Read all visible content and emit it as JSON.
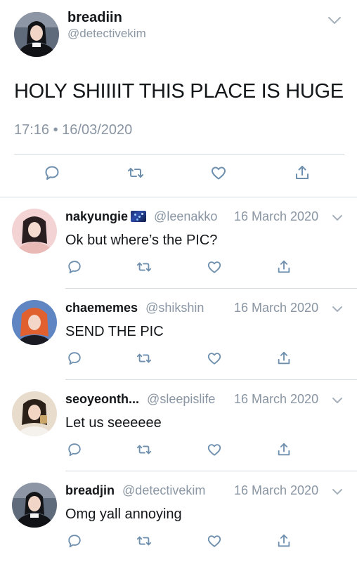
{
  "main_tweet": {
    "display_name": "breadiin",
    "handle": "@detectivekim",
    "text": "HOLY SHIIIIT THIS PLACE IS HUGE",
    "timestamp": "17:16 • 16/03/2020",
    "actions": [
      "reply-icon",
      "retweet-icon",
      "like-icon",
      "share-icon"
    ]
  },
  "replies": [
    {
      "display_name": "nakyungie",
      "has_flag_emoji": true,
      "handle": "@leenakko",
      "date": "16 March 2020",
      "text": "Ok but where’s the PIC?",
      "avatar_colors": [
        "#f2cfcf",
        "#2a1f22"
      ]
    },
    {
      "display_name": "chaememes",
      "handle": "@shikshin",
      "date": "16 March 2020",
      "text": "SEND THE PIC",
      "avatar_colors": [
        "#6b8fc4",
        "#e3663a"
      ]
    },
    {
      "display_name": "seoyeonth...",
      "handle": "@sleepislife",
      "date": "16 March 2020",
      "text": "Let us seeeeee",
      "avatar_colors": [
        "#e9dccb",
        "#2a2018"
      ]
    },
    {
      "display_name": "breadjin",
      "handle": "@detectivekim",
      "date": "16 March 2020",
      "text": "Omg yall annoying",
      "avatar_colors": [
        "#6a7585",
        "#1b1e24"
      ]
    }
  ],
  "colors": {
    "text": "#14171a",
    "secondary": "#8a96a3",
    "divider": "#d6dbe0",
    "icon": "#6e8fad"
  }
}
